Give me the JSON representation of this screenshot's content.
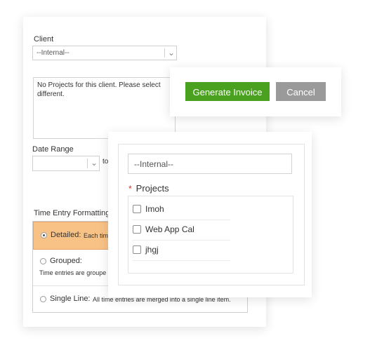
{
  "client": {
    "label": "Client",
    "value": "--Internal--",
    "message": "No Projects for this client. Please select different."
  },
  "date_range": {
    "label": "Date Range",
    "to_label": "to"
  },
  "format": {
    "label": "Time Entry Formatting",
    "options": [
      {
        "name": "Detailed:",
        "desc": "Each tim",
        "selected": true
      },
      {
        "name": "Grouped:",
        "desc": "Time entries are groupe",
        "selected": false
      },
      {
        "name": "Single Line:",
        "desc": "All time entries are merged into a single line item.",
        "selected": false
      }
    ]
  },
  "actions": {
    "generate_label": "Generate Invoice",
    "cancel_label": "Cancel"
  },
  "project_picker": {
    "client_value": "--Internal--",
    "required_mark": "*",
    "projects_label": "Projects",
    "items": [
      "Imoh",
      "Web App Cal",
      "jhgj"
    ]
  },
  "colors": {
    "accent_green": "#4aa11f",
    "cancel_gray": "#9a9a9a",
    "selected_orange": "#f8c286"
  }
}
